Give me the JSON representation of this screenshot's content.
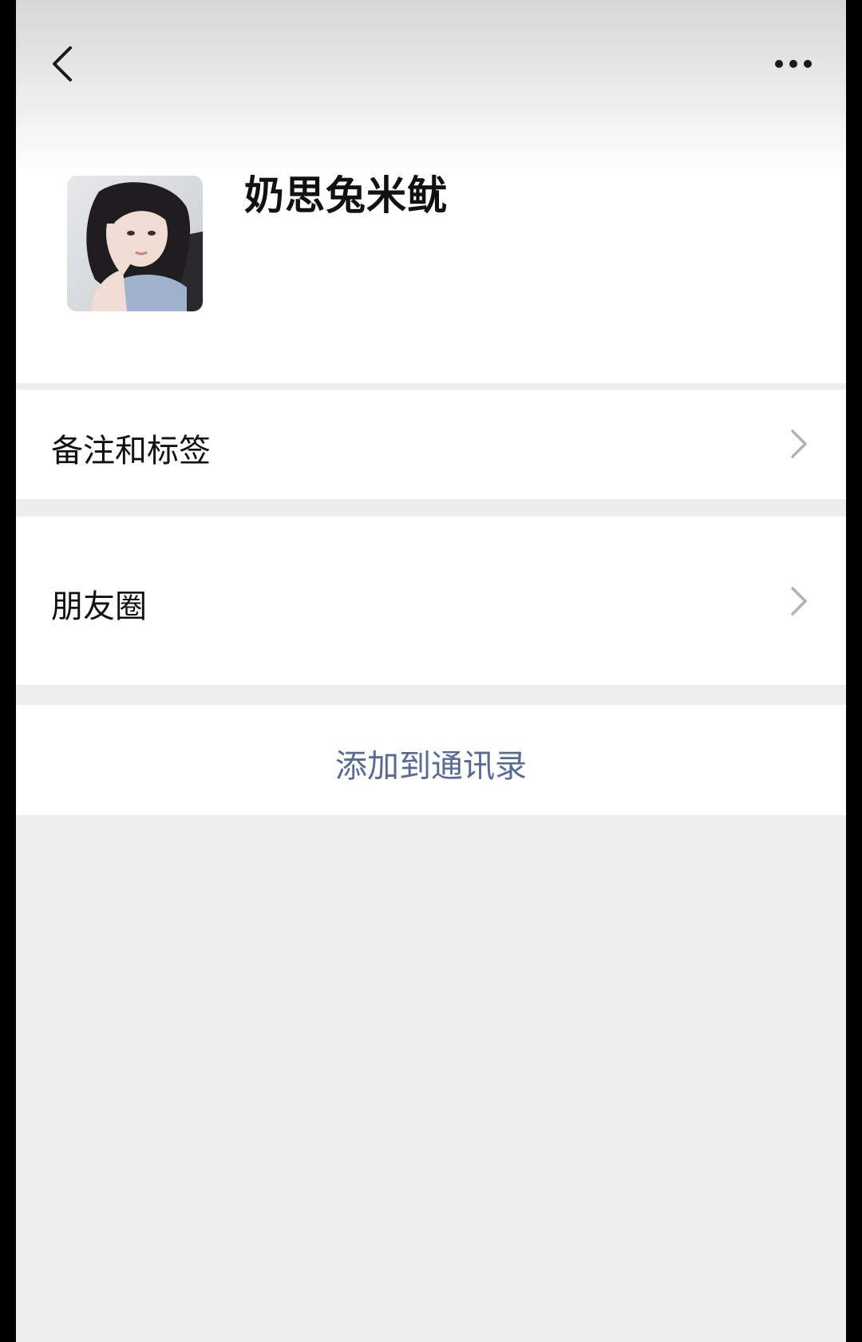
{
  "profile": {
    "name": "奶思兔米鱿"
  },
  "menu": {
    "notes_and_tags_label": "备注和标签",
    "moments_label": "朋友圈"
  },
  "actions": {
    "add_to_contacts_label": "添加到通讯录"
  },
  "icons": {
    "back": "chevron-left-icon",
    "more": "more-dots-icon",
    "row_arrow": "chevron-right-icon"
  },
  "colors": {
    "link_blue": "#576b95",
    "page_background": "#ededed",
    "card_background": "#ffffff"
  }
}
